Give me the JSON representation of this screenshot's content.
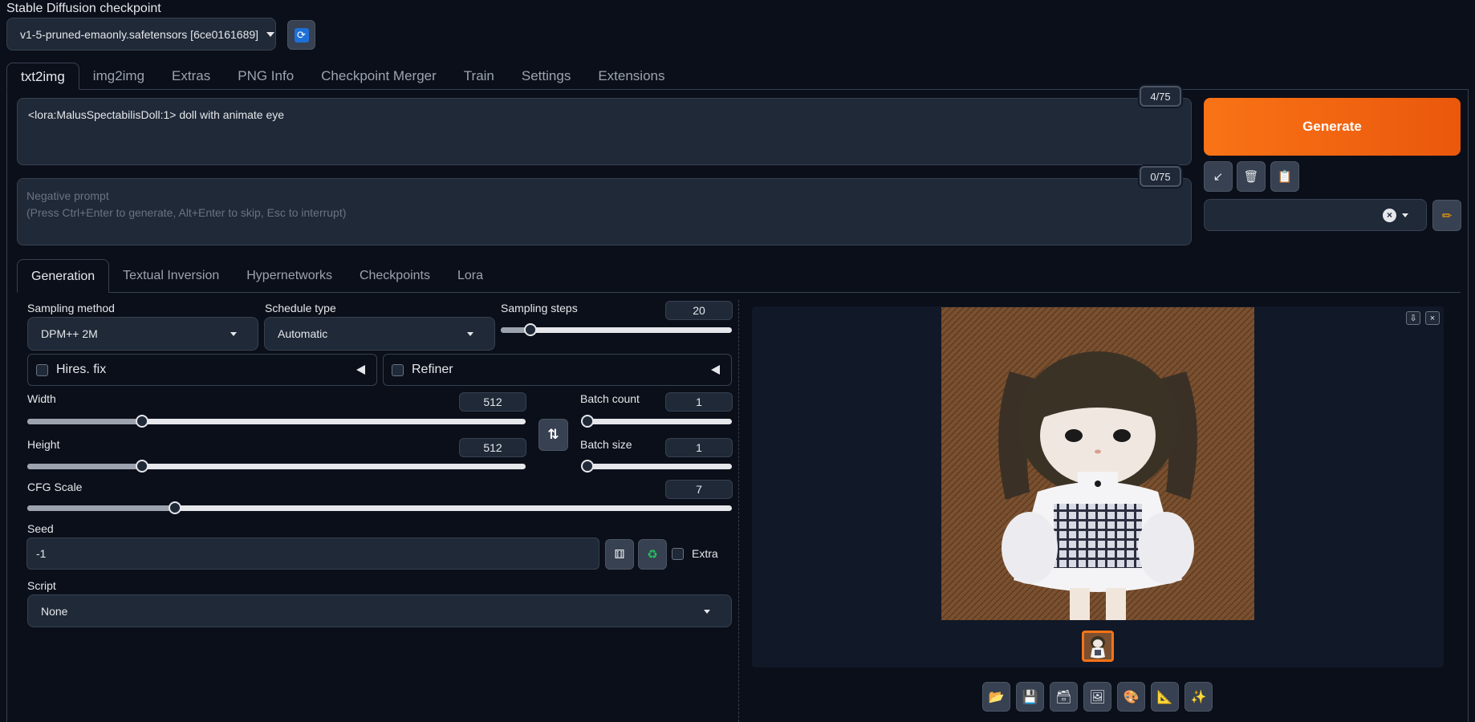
{
  "checkpoint": {
    "label": "Stable Diffusion checkpoint",
    "value": "v1-5-pruned-emaonly.safetensors [6ce0161689]"
  },
  "main_tabs": [
    {
      "label": "txt2img",
      "active": true
    },
    {
      "label": "img2img"
    },
    {
      "label": "Extras"
    },
    {
      "label": "PNG Info"
    },
    {
      "label": "Checkpoint Merger"
    },
    {
      "label": "Train"
    },
    {
      "label": "Settings"
    },
    {
      "label": "Extensions"
    }
  ],
  "prompt": {
    "value": "<lora:MalusSpectabilisDoll:1> doll with animate eye",
    "token_count": "4/75"
  },
  "negative_prompt": {
    "placeholder_line1": "Negative prompt",
    "placeholder_line2": "(Press Ctrl+Enter to generate, Alt+Enter to skip, Esc to interrupt)",
    "token_count": "0/75"
  },
  "generate_label": "Generate",
  "sub_tabs": [
    {
      "label": "Generation",
      "active": true
    },
    {
      "label": "Textual Inversion"
    },
    {
      "label": "Hypernetworks"
    },
    {
      "label": "Checkpoints"
    },
    {
      "label": "Lora"
    }
  ],
  "sampling_method": {
    "label": "Sampling method",
    "value": "DPM++ 2M"
  },
  "schedule_type": {
    "label": "Schedule type",
    "value": "Automatic"
  },
  "sampling_steps": {
    "label": "Sampling steps",
    "value": "20",
    "fraction": 0.13
  },
  "hires_fix": {
    "label": "Hires. fix"
  },
  "refiner": {
    "label": "Refiner"
  },
  "width": {
    "label": "Width",
    "value": "512",
    "fraction": 0.23
  },
  "height": {
    "label": "Height",
    "value": "512",
    "fraction": 0.23
  },
  "batch_count": {
    "label": "Batch count",
    "value": "1",
    "fraction": 0.0
  },
  "batch_size": {
    "label": "Batch size",
    "value": "1",
    "fraction": 0.0
  },
  "cfg_scale": {
    "label": "CFG Scale",
    "value": "7",
    "fraction": 0.21
  },
  "seed": {
    "label": "Seed",
    "value": "-1",
    "extra_label": "Extra"
  },
  "script": {
    "label": "Script",
    "value": "None"
  },
  "colors": {
    "accent": "#f97316",
    "background": "#0b0f19",
    "panel": "#1f2937"
  }
}
